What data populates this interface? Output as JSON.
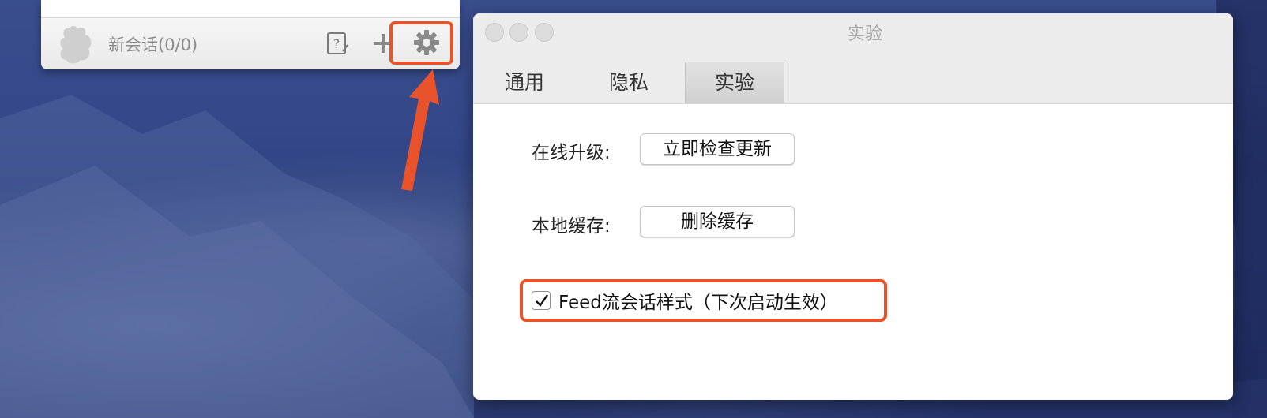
{
  "chat_window": {
    "session_label": "新会话(0/0)",
    "icons": [
      "avatar-icon",
      "help-icon",
      "plus-icon",
      "gear-icon"
    ]
  },
  "pref_window": {
    "title": "实验",
    "tabs": [
      {
        "label": "通用",
        "active": false
      },
      {
        "label": "隐私",
        "active": false
      },
      {
        "label": "实验",
        "active": true
      }
    ],
    "online_upgrade": {
      "label": "在线升级:",
      "button": "立即检查更新"
    },
    "local_cache": {
      "label": "本地缓存:",
      "button": "删除缓存"
    },
    "feed_option": {
      "label": "Feed流会话样式（下次启动生效）",
      "checked": true
    }
  },
  "colors": {
    "highlight": "#e8532b",
    "desktop": "#34488a"
  }
}
